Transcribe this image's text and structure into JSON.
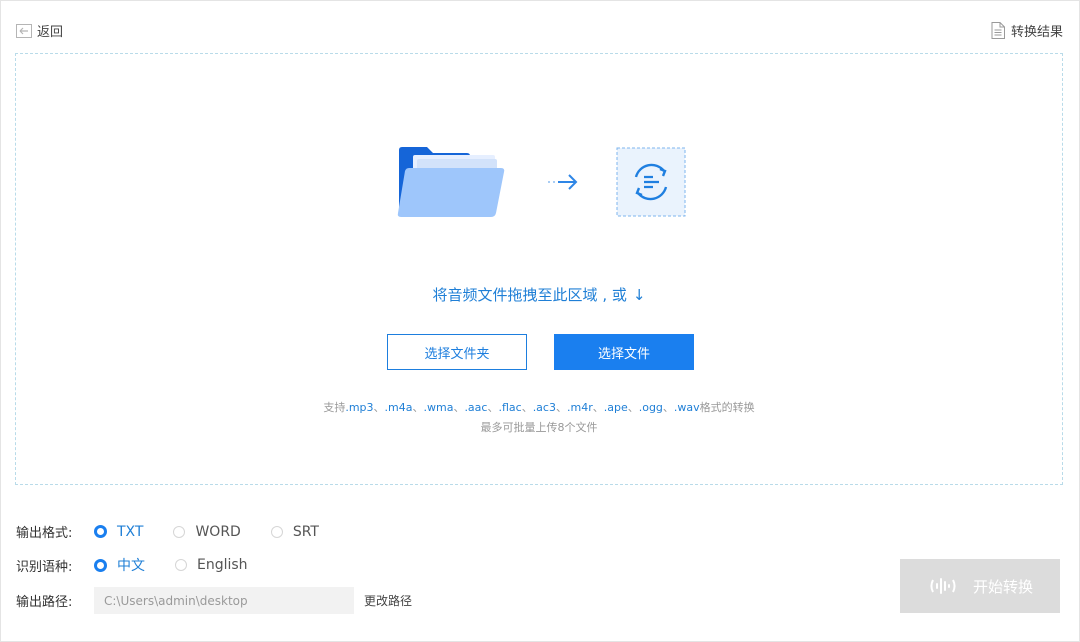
{
  "header": {
    "back_label": "返回",
    "result_label": "转换结果"
  },
  "dropzone": {
    "drop_text": "将音频文件拖拽至此区域 , 或",
    "drop_arrow": "↓",
    "select_folder_label": "选择文件夹",
    "select_file_label": "选择文件",
    "support_prefix": "支持",
    "support_formats": [
      ".mp3",
      ".m4a",
      ".wma",
      ".aac",
      ".flac",
      ".ac3",
      ".m4r",
      ".ape",
      ".ogg",
      ".wav"
    ],
    "support_separator": "、",
    "support_suffix": "格式的转换",
    "max_files": "最多可批量上传8个文件"
  },
  "options": {
    "format_label": "输出格式:",
    "formats": [
      {
        "label": "TXT",
        "checked": true
      },
      {
        "label": "WORD",
        "checked": false
      },
      {
        "label": "SRT",
        "checked": false
      }
    ],
    "language_label": "识别语种:",
    "languages": [
      {
        "label": "中文",
        "checked": true
      },
      {
        "label": "English",
        "checked": false
      }
    ],
    "path_label": "输出路径:",
    "path_value": "C:\\Users\\admin\\desktop",
    "change_path_label": "更改路径"
  },
  "start_button": {
    "label": "开始转换",
    "icon": "sound-wave-icon"
  },
  "colors": {
    "accent": "#1a7fef",
    "accent_text": "#1f7fd6",
    "disabled": "#dcdcdc",
    "dashed_border": "#b9dbe9"
  }
}
